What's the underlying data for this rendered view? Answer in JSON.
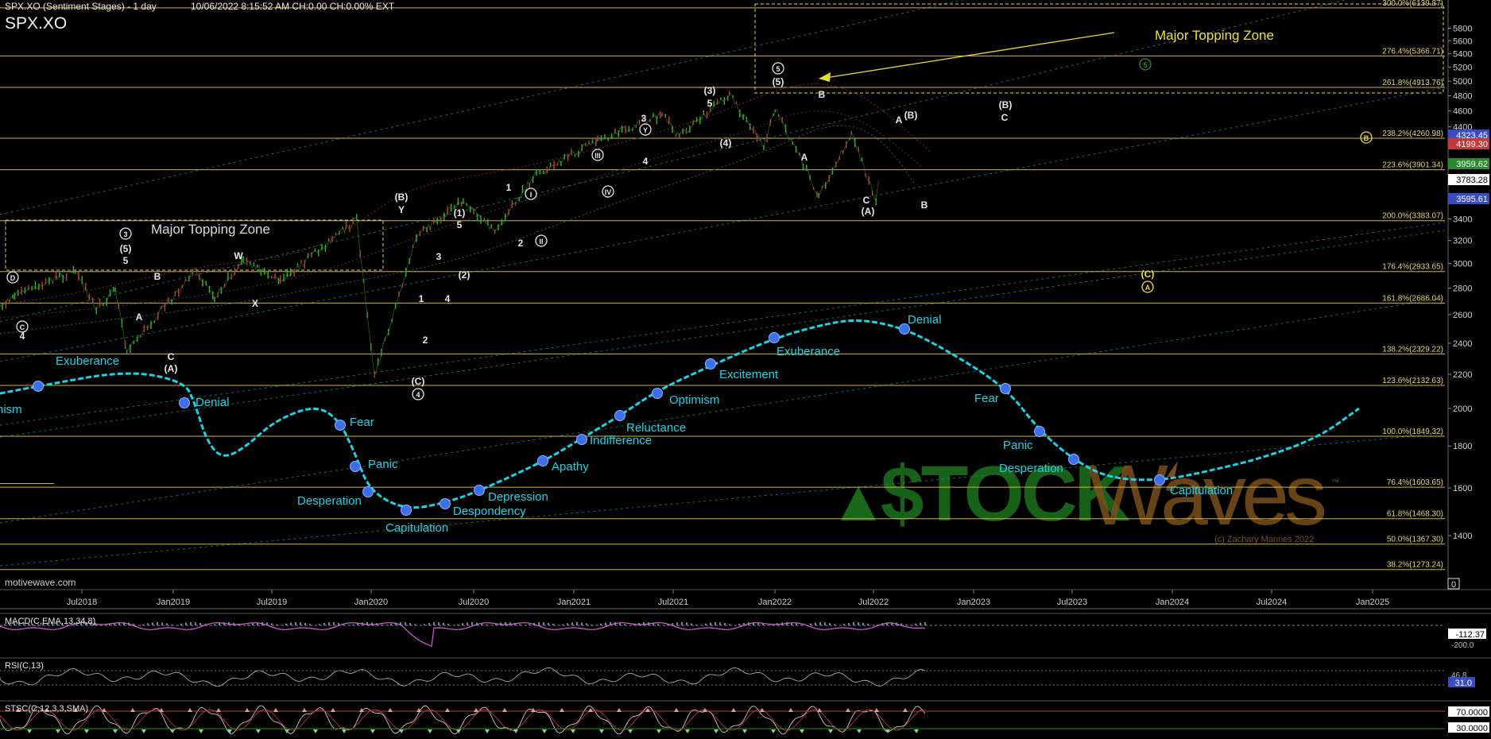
{
  "header": {
    "study": "SPX.XO (Sentiment Stages) - 1 day",
    "meta": "10/06/2022 8:15:52 AM  CH:0.00  CH:0.00%  EXT",
    "symbol": "SPX.XO"
  },
  "footer": {
    "site": "motivewave.com"
  },
  "colors": {
    "background": "#000000",
    "fib_line": "#d4b43c",
    "fib_text": "#e6d470",
    "sentiment_curve": "#17d5e8",
    "sentiment_dot": "#3d6fe8",
    "channel": "#1e8f86",
    "price_up": "#36b92d",
    "price_down": "#d23535",
    "label": "#e8e8e8",
    "watermark_green": "#1f7a1f",
    "watermark_brown": "#7a4f1c"
  },
  "chart_data": {
    "type": "line",
    "title": "SPX.XO (Sentiment Stages) - 1 day",
    "x_ticks": [
      "Jul2018",
      "Jan2019",
      "Jul2019",
      "Jan2020",
      "Jul2020",
      "Jan2021",
      "Jul2021",
      "Jan2022",
      "Jul2022",
      "Jan2023",
      "Jul2023",
      "Jan2024",
      "Jul2024",
      "Jan2025"
    ],
    "y_ticks": [
      1400,
      1600,
      1800,
      2000,
      2200,
      2400,
      2600,
      2800,
      3000,
      3200,
      3400,
      3600,
      3800,
      4000,
      4200,
      4400,
      4600,
      4800,
      5000,
      5200,
      5400,
      5600,
      5800
    ],
    "ylim": [
      1250,
      6150
    ],
    "log_scale": true,
    "price_series": {
      "name": "SPX.XO",
      "points": [
        {
          "x": "2018-04-01",
          "y": 2580
        },
        {
          "x": "2018-06-01",
          "y": 2740
        },
        {
          "x": "2018-09-20",
          "y": 2940
        },
        {
          "x": "2018-10-29",
          "y": 2640
        },
        {
          "x": "2018-12-03",
          "y": 2790
        },
        {
          "x": "2018-12-24",
          "y": 2350
        },
        {
          "x": "2019-04-30",
          "y": 2945
        },
        {
          "x": "2019-06-03",
          "y": 2740
        },
        {
          "x": "2019-07-26",
          "y": 3025
        },
        {
          "x": "2019-10-02",
          "y": 2855
        },
        {
          "x": "2020-02-19",
          "y": 3390
        },
        {
          "x": "2020-03-23",
          "y": 2190
        },
        {
          "x": "2020-06-08",
          "y": 3230
        },
        {
          "x": "2020-09-02",
          "y": 3590
        },
        {
          "x": "2020-10-30",
          "y": 3270
        },
        {
          "x": "2021-01-08",
          "y": 3820
        },
        {
          "x": "2021-05-07",
          "y": 4240
        },
        {
          "x": "2021-09-02",
          "y": 4550
        },
        {
          "x": "2021-10-04",
          "y": 4280
        },
        {
          "x": "2022-01-04",
          "y": 4820
        },
        {
          "x": "2022-03-08",
          "y": 4160
        },
        {
          "x": "2022-03-29",
          "y": 4640
        },
        {
          "x": "2022-06-17",
          "y": 3630
        },
        {
          "x": "2022-08-16",
          "y": 4320
        },
        {
          "x": "2022-09-30",
          "y": 3580
        },
        {
          "x": "2022-10-05",
          "y": 3783
        }
      ]
    },
    "price_labels": [
      "4323.45",
      "4199.30",
      "3959.62",
      "3783.28",
      "3595.61"
    ],
    "fib_levels": [
      {
        "label": "300.0%(6139.87)",
        "value": 6139.87
      },
      {
        "label": "276.4%(5366.71)",
        "value": 5366.71
      },
      {
        "label": "261.8%(4913.76)",
        "value": 4913.76
      },
      {
        "label": "238.2%(4260.98)",
        "value": 4260.98
      },
      {
        "label": "223.6%(3901.34)",
        "value": 3901.34
      },
      {
        "label": "200.0%(3383.07)",
        "value": 3383.07
      },
      {
        "label": "176.4%(2933.65)",
        "value": 2933.65
      },
      {
        "label": "161.8%(2686.04)",
        "value": 2686.04
      },
      {
        "label": "138.2%(2329.22)",
        "value": 2329.22
      },
      {
        "label": "123.6%(2132.63)",
        "value": 2132.63
      },
      {
        "label": "100.0%(1849.32)",
        "value": 1849.32
      },
      {
        "label": "76.4%(1603.65)",
        "value": 1603.65
      },
      {
        "label": "61.8%(1468.30)",
        "value": 1468.3
      },
      {
        "label": "50.0%(1367.30)",
        "value": 1367.3
      },
      {
        "label": "38.2%(1273.24)",
        "value": 1273.24
      }
    ],
    "sentiment_stages": [
      {
        "label": "nism"
      },
      {
        "label": "Exuberance"
      },
      {
        "label": "Denial"
      },
      {
        "label": "Fear"
      },
      {
        "label": "Panic"
      },
      {
        "label": "Desperation"
      },
      {
        "label": "Capitulation"
      },
      {
        "label": "Despondency"
      },
      {
        "label": "Depression"
      },
      {
        "label": "Apathy"
      },
      {
        "label": "Indifference"
      },
      {
        "label": "Reluctance"
      },
      {
        "label": "Optimism"
      },
      {
        "label": "Excitement"
      },
      {
        "label": "Exuberance"
      },
      {
        "label": "Denial"
      },
      {
        "label": "Fear"
      },
      {
        "label": "Panic"
      },
      {
        "label": "Desperation"
      },
      {
        "label": "Capitulation"
      }
    ],
    "wave_labels": [
      {
        "text": "D",
        "circled": true
      },
      {
        "text": "C",
        "circled": true
      },
      {
        "text": "4"
      },
      {
        "text": "3",
        "circled": true
      },
      {
        "text": "(5)"
      },
      {
        "text": "5"
      },
      {
        "text": "A"
      },
      {
        "text": "B"
      },
      {
        "text": "C"
      },
      {
        "text": "(A)"
      },
      {
        "text": "W"
      },
      {
        "text": "X"
      },
      {
        "text": "(B)"
      },
      {
        "text": "Y"
      },
      {
        "text": "1"
      },
      {
        "text": "2"
      },
      {
        "text": "3"
      },
      {
        "text": "4"
      },
      {
        "text": "(C)"
      },
      {
        "text": "4",
        "circled": true
      },
      {
        "text": "(1)"
      },
      {
        "text": "5"
      },
      {
        "text": "(2)"
      },
      {
        "text": "1"
      },
      {
        "text": "2"
      },
      {
        "text": "I",
        "circled": true
      },
      {
        "text": "II",
        "circled": true
      },
      {
        "text": "III",
        "circled": true
      },
      {
        "text": "IV",
        "circled": true
      },
      {
        "text": "3"
      },
      {
        "text": "Y",
        "circled": true
      },
      {
        "text": "4"
      },
      {
        "text": "(3)"
      },
      {
        "text": "5"
      },
      {
        "text": "(4)"
      },
      {
        "text": "5",
        "circled": true
      },
      {
        "text": "(5)"
      },
      {
        "text": "B"
      },
      {
        "text": "A"
      },
      {
        "text": "A"
      },
      {
        "text": "(B)"
      },
      {
        "text": "C"
      },
      {
        "text": "(A)"
      },
      {
        "text": "B"
      },
      {
        "text": "(B)"
      },
      {
        "text": "C"
      },
      {
        "text": "5",
        "circled": true
      },
      {
        "text": "B",
        "circled": true
      },
      {
        "text": "(C)"
      },
      {
        "text": "A",
        "circled": true
      }
    ],
    "annotations": [
      "Major Topping Zone",
      "Major Topping Zone",
      "(c) Zachary Mannes 2022"
    ],
    "watermark": {
      "left": "$TOCK",
      "right": "Waves",
      "tm": "™"
    },
    "indicators": [
      {
        "name": "MACD",
        "title": "MACD(C,EMA,13,34,8)",
        "value_label": "-112.37",
        "tick_label": "-200.0"
      },
      {
        "name": "RSI",
        "title": "RSI(C,13)",
        "value_label": "31.0",
        "tick_label": "46.8"
      },
      {
        "name": "SlowStoch",
        "title": "STSC(C,12,3,3,SMA)",
        "value_label": "70.0000",
        "tick_label": "30.0000"
      }
    ],
    "zero_label": "0",
    "grid": false,
    "legend": "none"
  }
}
